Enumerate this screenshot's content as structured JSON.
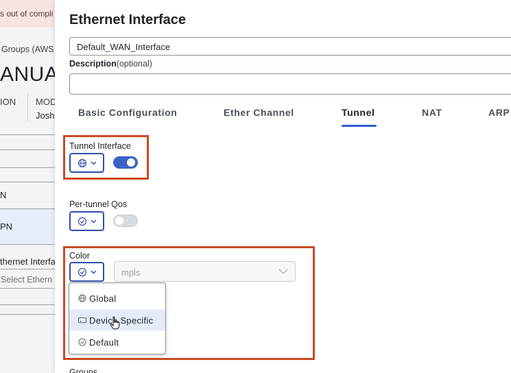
{
  "background": {
    "alert_text": "s out of compli",
    "groups_text": "Groups (AWS",
    "big_text": "ANUA",
    "col1_label": "ION",
    "col2_label": "MOD",
    "col2_value": "Josh",
    "row_n": "N",
    "row_pn": "PN",
    "row_ethernet": "thernet Interfa",
    "select_placeholder": "Select Ethern"
  },
  "panel": {
    "title": "Ethernet Interface",
    "name_value": "Default_WAN_Interface",
    "description_label": "Description",
    "description_optional": "(optional)",
    "description_value": ""
  },
  "tabs": [
    {
      "label": "Basic Configuration",
      "active": false
    },
    {
      "label": "Ether Channel",
      "active": false
    },
    {
      "label": "Tunnel",
      "active": true
    },
    {
      "label": "NAT",
      "active": false
    },
    {
      "label": "ARP",
      "active": false
    }
  ],
  "fields": {
    "tunnel_interface": {
      "label": "Tunnel Interface",
      "scope_icon": "globe-icon",
      "toggle_on": true
    },
    "per_tunnel_qos": {
      "label": "Per-tunnel Qos",
      "scope_icon": "check-circle-icon",
      "toggle_on": false
    },
    "color": {
      "label": "Color",
      "scope_icon": "check-circle-icon",
      "value": "mpls"
    },
    "groups": {
      "label": "Groups"
    }
  },
  "dropdown": {
    "options": [
      {
        "label": "Global",
        "icon": "globe-icon",
        "hovered": false
      },
      {
        "label": "Device Specific",
        "icon": "device-icon",
        "hovered": true
      },
      {
        "label": "Default",
        "icon": "check-circle-icon",
        "hovered": false
      }
    ]
  },
  "colors": {
    "accent": "#2d5bd6",
    "toggle_on": "#3d62c6",
    "highlight": "#c94a20",
    "hover": "#e4eaf7"
  }
}
